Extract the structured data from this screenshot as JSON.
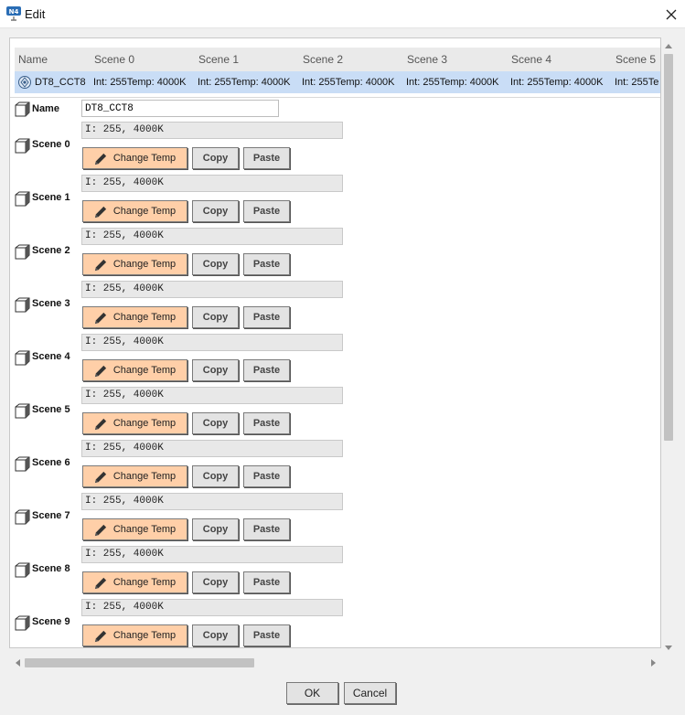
{
  "window": {
    "title": "Edit",
    "icon_badge": "N4"
  },
  "table": {
    "headers": [
      "Name",
      "Scene 0",
      "Scene 1",
      "Scene 2",
      "Scene 3",
      "Scene 4",
      "Scene 5"
    ],
    "row": {
      "name": "DT8_CCT8",
      "cells": [
        "Int: 255Temp: 4000K",
        "Int: 255Temp: 4000K",
        "Int: 255Temp: 4000K",
        "Int: 255Temp: 4000K",
        "Int: 255Temp: 4000K",
        "Int: 255Te"
      ]
    }
  },
  "form": {
    "name_label": "Name",
    "name_value": "DT8_CCT8",
    "scenes": [
      {
        "label": "Scene 0",
        "value": "I: 255, 4000K"
      },
      {
        "label": "Scene 1",
        "value": "I: 255, 4000K"
      },
      {
        "label": "Scene 2",
        "value": "I: 255, 4000K"
      },
      {
        "label": "Scene 3",
        "value": "I: 255, 4000K"
      },
      {
        "label": "Scene 4",
        "value": "I: 255, 4000K"
      },
      {
        "label": "Scene 5",
        "value": "I: 255, 4000K"
      },
      {
        "label": "Scene 6",
        "value": "I: 255, 4000K"
      },
      {
        "label": "Scene 7",
        "value": "I: 255, 4000K"
      },
      {
        "label": "Scene 8",
        "value": "I: 255, 4000K"
      },
      {
        "label": "Scene 9",
        "value": "I: 255, 4000K"
      }
    ],
    "buttons": {
      "change_temp": "Change Temp",
      "copy": "Copy",
      "paste": "Paste"
    }
  },
  "footer": {
    "ok": "OK",
    "cancel": "Cancel"
  },
  "colors": {
    "change_temp_bg": "#ffcfa8",
    "selected_row_bg": "#c9ddf6",
    "header_bg": "#eaeaea"
  },
  "icons": {
    "app": "niagara-app-icon",
    "close": "close-icon",
    "row": "dali-device-icon",
    "field": "property-box-icon",
    "edit": "pencil-icon"
  }
}
